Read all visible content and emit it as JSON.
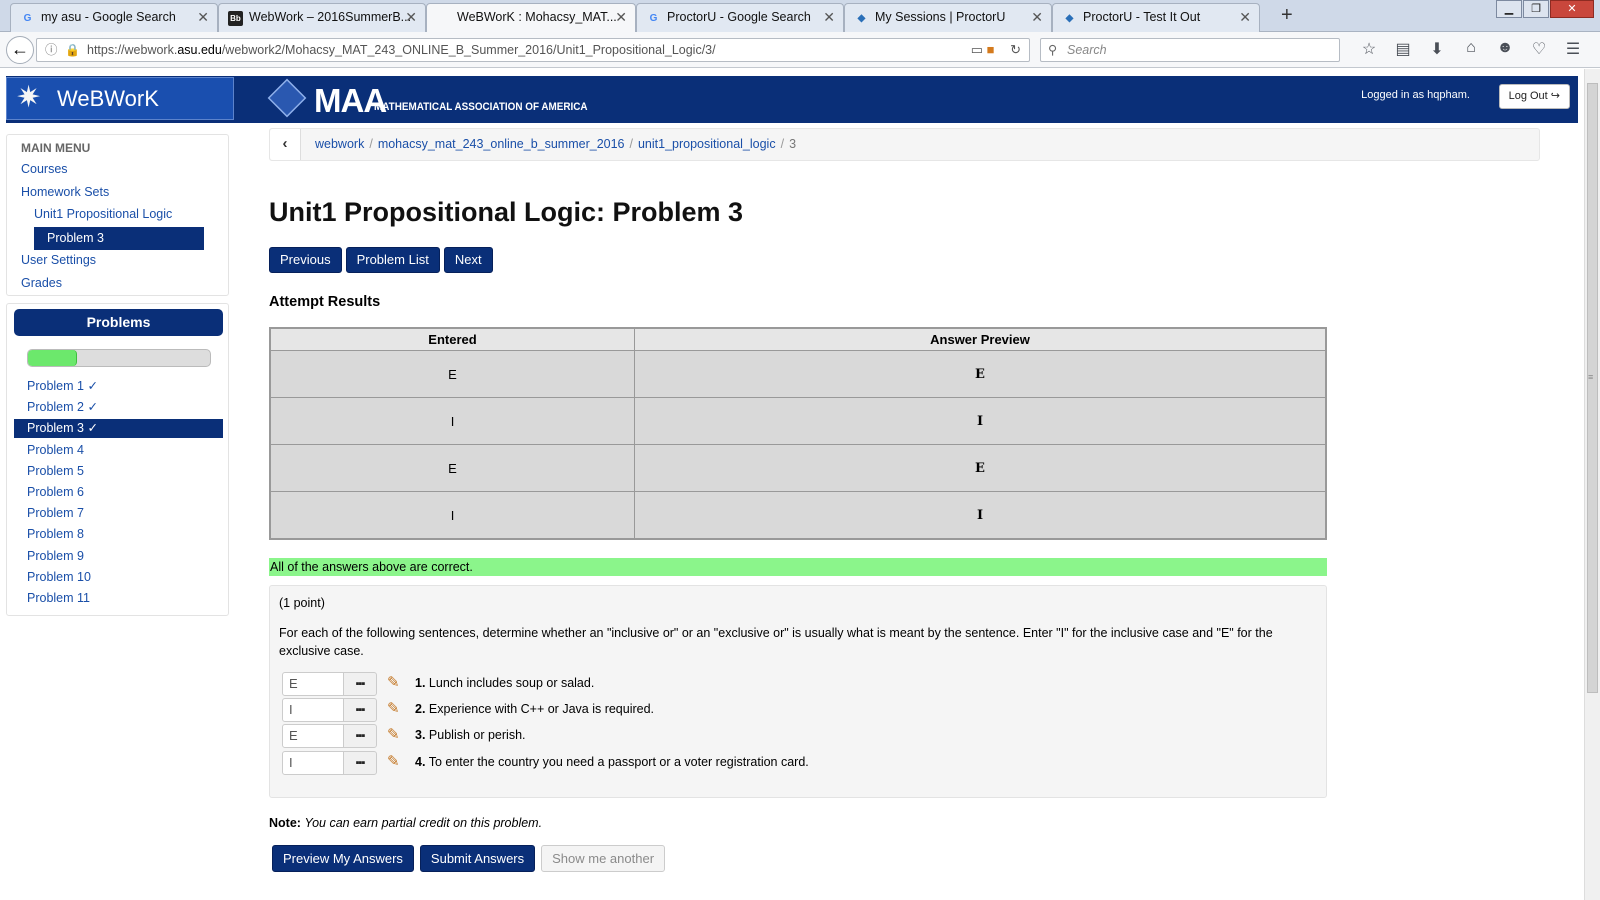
{
  "browser": {
    "tabs": [
      {
        "title": "my asu - Google Search",
        "favicon": "G"
      },
      {
        "title": "WebWork – 2016SummerB...",
        "favicon": "Bb"
      },
      {
        "title": "WeBWorK : Mohacsy_MAT...",
        "favicon": ""
      },
      {
        "title": "ProctorU - Google Search",
        "favicon": "G"
      },
      {
        "title": "My Sessions | ProctorU",
        "favicon": "P"
      },
      {
        "title": "ProctorU - Test It Out",
        "favicon": "P"
      }
    ],
    "url_prefix": "https://webwork.",
    "url_host": "asu.edu",
    "url_path": "/webwork2/Mohacsy_MAT_243_ONLINE_B_Summer_2016/Unit1_Propositional_Logic/3/",
    "search_placeholder": "Search"
  },
  "header": {
    "logo": "WeBWorK",
    "maa_big": "MAA",
    "maa_sub": "MATHEMATICAL ASSOCIATION OF AMERICA",
    "logged_in": "Logged in as hqpham.",
    "logout": "Log Out"
  },
  "sidebar": {
    "main_menu_title": "MAIN MENU",
    "courses": "Courses",
    "homework_sets": "Homework Sets",
    "set_name": "Unit1 Propositional Logic",
    "current_problem": "Problem 3",
    "user_settings": "User Settings",
    "grades": "Grades",
    "problems_title": "Problems",
    "progress": 0.27,
    "problems": [
      "Problem 1 ✓",
      "Problem 2 ✓",
      "Problem 3 ✓",
      "Problem 4",
      "Problem 5",
      "Problem 6",
      "Problem 7",
      "Problem 8",
      "Problem 9",
      "Problem 10",
      "Problem 11"
    ],
    "selected_index": 2
  },
  "breadcrumb": {
    "items": [
      "webwork",
      "mohacsy_mat_243_online_b_summer_2016",
      "unit1_propositional_logic"
    ],
    "current": "3"
  },
  "main": {
    "title": "Unit1 Propositional Logic: Problem 3",
    "nav": {
      "previous": "Previous",
      "list": "Problem List",
      "next": "Next"
    },
    "attempt_heading": "Attempt Results",
    "results_headers": {
      "entered": "Entered",
      "preview": "Answer Preview"
    },
    "results": [
      {
        "entered": "E",
        "preview": "E"
      },
      {
        "entered": "I",
        "preview": "I"
      },
      {
        "entered": "E",
        "preview": "E"
      },
      {
        "entered": "I",
        "preview": "I"
      }
    ],
    "correct_msg": "All of the answers above are correct.",
    "points": "(1 point)",
    "instructions": "For each of the following sentences, determine whether an \"inclusive or\" or an \"exclusive or\" is usually what is meant by the sentence. Enter \"I\" for the inclusive case and \"E\" for the exclusive case.",
    "answers": [
      {
        "value": "E",
        "num": "1.",
        "text": "Lunch includes soup or salad."
      },
      {
        "value": "I",
        "num": "2.",
        "text": "Experience with C++ or Java is required."
      },
      {
        "value": "E",
        "num": "3.",
        "text": "Publish or perish."
      },
      {
        "value": "I",
        "num": "4.",
        "text": "To enter the country you need a passport or a voter registration card."
      }
    ],
    "note_label": "Note:",
    "note_text": "You can earn partial credit on this problem.",
    "buttons": {
      "preview": "Preview My Answers",
      "submit": "Submit Answers",
      "another": "Show me another"
    }
  }
}
